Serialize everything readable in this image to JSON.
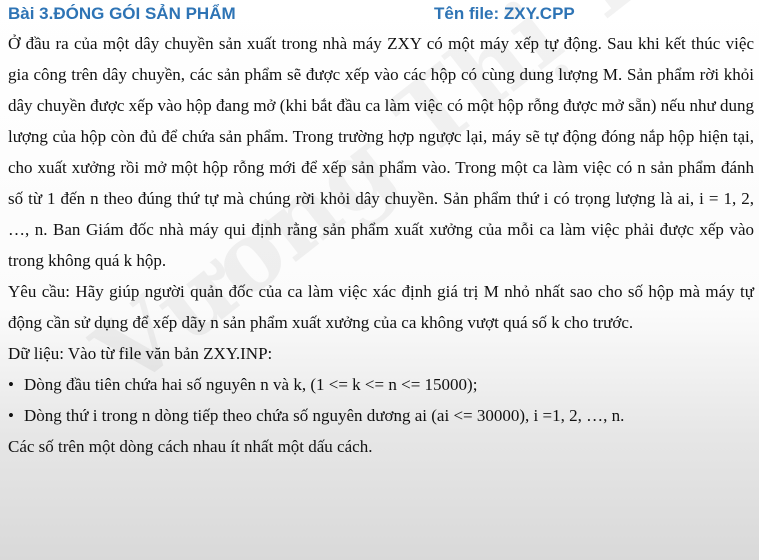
{
  "header": {
    "title": "Bài 3.ĐÓNG GÓI SẢN PHẨM",
    "file": "Tên file: ZXY.CPP",
    "color": "#2e74b5"
  },
  "body": {
    "paragraph1": "Ở đầu ra của một dây chuyền sản xuất trong nhà máy ZXY có một máy xếp tự động. Sau khi kết thúc việc gia công  trên dây chuyền, các  sản phẩm sẽ được xếp vào các hộp có cùng dung lượng M. Sản phẩm rời khỏi dây chuyền được xếp vào hộp đang mở (khi bắt đầu ca làm việc có một hộp rỗng được mở sẵn) nếu như dung lượng của hộp còn đủ để chứa sản phẩm. Trong trường hợp ngược lại, máy sẽ tự động đóng nắp hộp hiện tại, cho xuất xưởng rồi mở một hộp rỗng mới để xếp sản phẩm vào. Trong một ca làm việc có n sản phẩm đánh số từ 1 đến n theo đúng thứ tự mà chúng rời khỏi dây chuyền. Sản phẩm thứ i có trọng lượng là ai, i = 1, 2, …, n. Ban Giám đốc nhà máy qui định rằng sản phẩm xuất xưởng của mỗi ca làm việc phải được xếp vào trong không quá k hộp.",
    "requirement": "Yêu cầu: Hãy giúp người quản đốc của ca  làm việc xác định giá  trị M nhỏ nhất sao cho số hộp mà máy tự động cần sử dụng để xếp dãy n sản phẩm xuất xưởng của ca không vượt quá số k cho trước.",
    "input_heading": "Dữ liệu: Vào từ file văn bản ZXY.INP:",
    "bullets": [
      "Dòng đầu tiên chứa hai số nguyên n và k, (1 <= k <= n <= 15000);",
      "Dòng thứ i trong n dòng tiếp theo chứa số nguyên dương ai (ai <= 30000), i =1, 2, …, n."
    ],
    "bullet_symbol": "•",
    "closing": "Các số trên một dòng cách nhau ít nhất một dấu cách."
  },
  "watermark": "Vương Thị Thanh"
}
